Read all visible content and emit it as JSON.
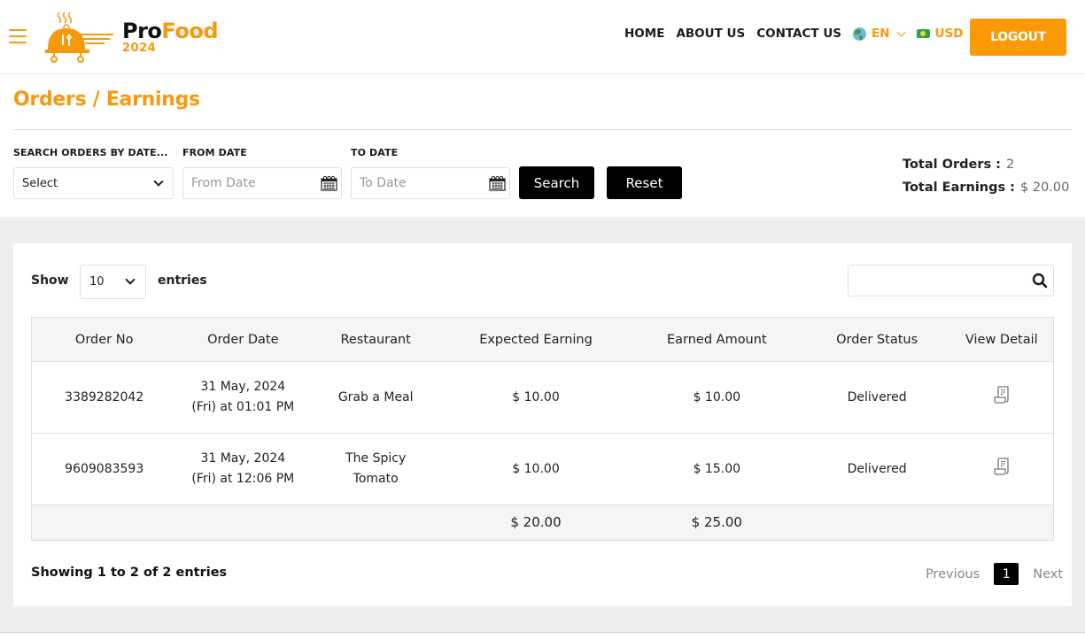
{
  "brand": {
    "name_part1": "Pro",
    "name_part2": "Food",
    "year": "2024",
    "accent": "#f7990d"
  },
  "nav": {
    "items": [
      "HOME",
      "ABOUT US",
      "CONTACT US"
    ],
    "language": "EN",
    "currency": "USD",
    "logout_label": "LOGOUT"
  },
  "page": {
    "title": "Orders / Earnings"
  },
  "filters": {
    "search_by_label": "SEARCH ORDERS BY DATE...",
    "search_by_value": "Select",
    "from_label": "FROM DATE",
    "from_placeholder": "From Date",
    "to_label": "TO DATE",
    "to_placeholder": "To Date",
    "search_label": "Search",
    "reset_label": "Reset"
  },
  "totals": {
    "orders_label": "Total Orders :",
    "orders_value": "2",
    "earnings_label": "Total Earnings :",
    "earnings_value": "$ 20.00"
  },
  "table_controls": {
    "show_label": "Show",
    "page_length": "10",
    "entries_label": "entries",
    "search_value": ""
  },
  "table": {
    "headers": [
      "Order No",
      "Order Date",
      "Restaurant",
      "Expected Earning",
      "Earned Amount",
      "Order Status",
      "View Detail"
    ],
    "rows": [
      {
        "order_no": "3389282042",
        "date_line1": "31 May, 2024",
        "date_line2": "(Fri) at 01:01 PM",
        "restaurant_line1": "Grab a Meal",
        "restaurant_line2": "",
        "expected": "$ 10.00",
        "earned": "$ 10.00",
        "status": "Delivered"
      },
      {
        "order_no": "9609083593",
        "date_line1": "31 May, 2024",
        "date_line2": "(Fri) at 12:06 PM",
        "restaurant_line1": "The Spicy",
        "restaurant_line2": "Tomato",
        "expected": "$ 10.00",
        "earned": "$ 15.00",
        "status": "Delivered"
      }
    ],
    "total_expected": "$ 20.00",
    "total_earned": "$ 25.00"
  },
  "footer": {
    "showing": "Showing 1 to 2 of 2 entries",
    "previous": "Previous",
    "current_page": "1",
    "next": "Next"
  }
}
